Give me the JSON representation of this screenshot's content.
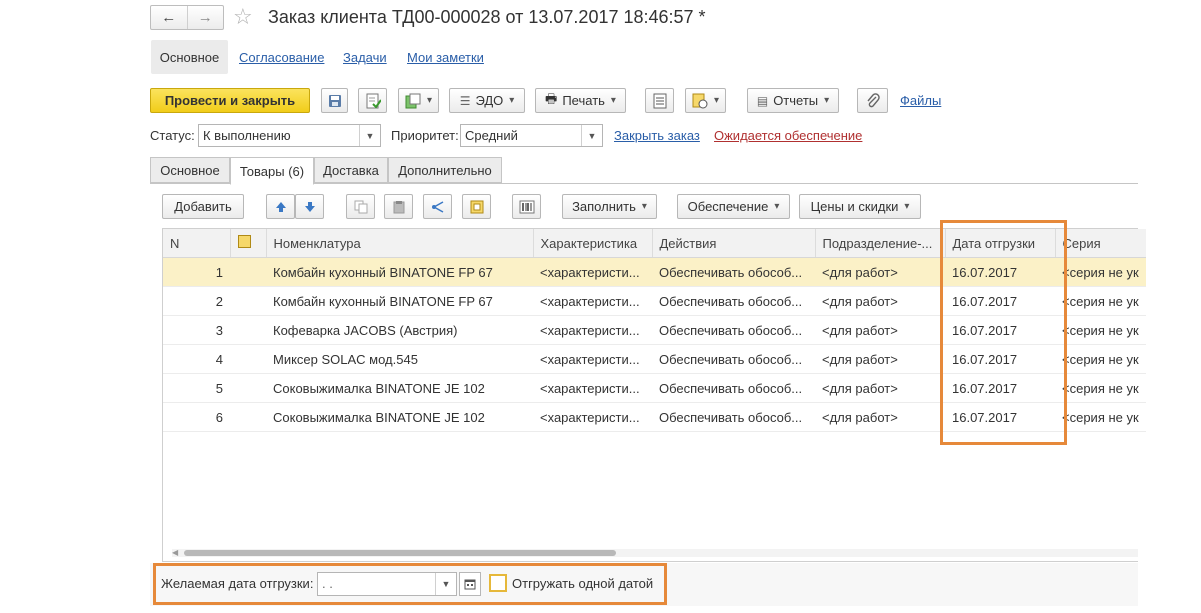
{
  "window": {
    "title": "Заказ клиента ТД00-000028 от 13.07.2017 18:46:57 *"
  },
  "nav": {
    "back": "←",
    "forward": "→",
    "star": "☆"
  },
  "section_tabs": [
    "Основное",
    "Согласование",
    "Задачи",
    "Мои заметки"
  ],
  "toolbar": {
    "post_close": "Провести и закрыть",
    "edo": "ЭДО",
    "print": "Печать",
    "reports": "Отчеты",
    "files": "Файлы"
  },
  "status_row": {
    "status_label": "Статус:",
    "status_value": "К выполнению",
    "priority_label": "Приоритет:",
    "priority_value": "Средний",
    "close_order": "Закрыть заказ",
    "awaiting": "Ожидается обеспечение"
  },
  "page_tabs": [
    "Основное",
    "Товары (6)",
    "Доставка",
    "Дополнительно"
  ],
  "grid_toolbar": {
    "add": "Добавить",
    "fill": "Заполнить",
    "provision": "Обеспечение",
    "prices": "Цены и скидки"
  },
  "table": {
    "columns": [
      "N",
      "",
      "Номенклатура",
      "Характеристика",
      "Действия",
      "Подразделение-...",
      "Дата отгрузки",
      "Серия"
    ],
    "rows": [
      {
        "n": "1",
        "name": "Комбайн кухонный BINATONE FP 67",
        "char": "<характеристи...",
        "action": "Обеспечивать обособ...",
        "dept": "<для работ>",
        "date": "16.07.2017",
        "series": "<серия не ук"
      },
      {
        "n": "2",
        "name": "Комбайн кухонный BINATONE FP 67",
        "char": "<характеристи...",
        "action": "Обеспечивать обособ...",
        "dept": "<для работ>",
        "date": "16.07.2017",
        "series": "<серия не ук"
      },
      {
        "n": "3",
        "name": "Кофеварка JACOBS (Австрия)",
        "char": "<характеристи...",
        "action": "Обеспечивать обособ...",
        "dept": "<для работ>",
        "date": "16.07.2017",
        "series": "<серия не ук"
      },
      {
        "n": "4",
        "name": "Миксер SOLAC мод.545",
        "char": "<характеристи...",
        "action": "Обеспечивать обособ...",
        "dept": "<для работ>",
        "date": "16.07.2017",
        "series": "<серия не ук"
      },
      {
        "n": "5",
        "name": "Соковыжималка  BINATONE JE 102",
        "char": "<характеристи...",
        "action": "Обеспечивать обособ...",
        "dept": "<для работ>",
        "date": "16.07.2017",
        "series": "<серия не ук"
      },
      {
        "n": "6",
        "name": "Соковыжималка  BINATONE JE 102",
        "char": "<характеристи...",
        "action": "Обеспечивать обособ...",
        "dept": "<для работ>",
        "date": "16.07.2017",
        "series": "<серия не ук"
      }
    ]
  },
  "footer": {
    "date_label": "Желаемая дата отгрузки:",
    "date_value": " .  .",
    "same_date_label": "Отгружать одной датой"
  },
  "colors": {
    "accent_yellow": "#f5d426",
    "highlight_orange": "#e6893a",
    "selected_row": "#fbf1c7",
    "link": "#2a5ea8"
  }
}
